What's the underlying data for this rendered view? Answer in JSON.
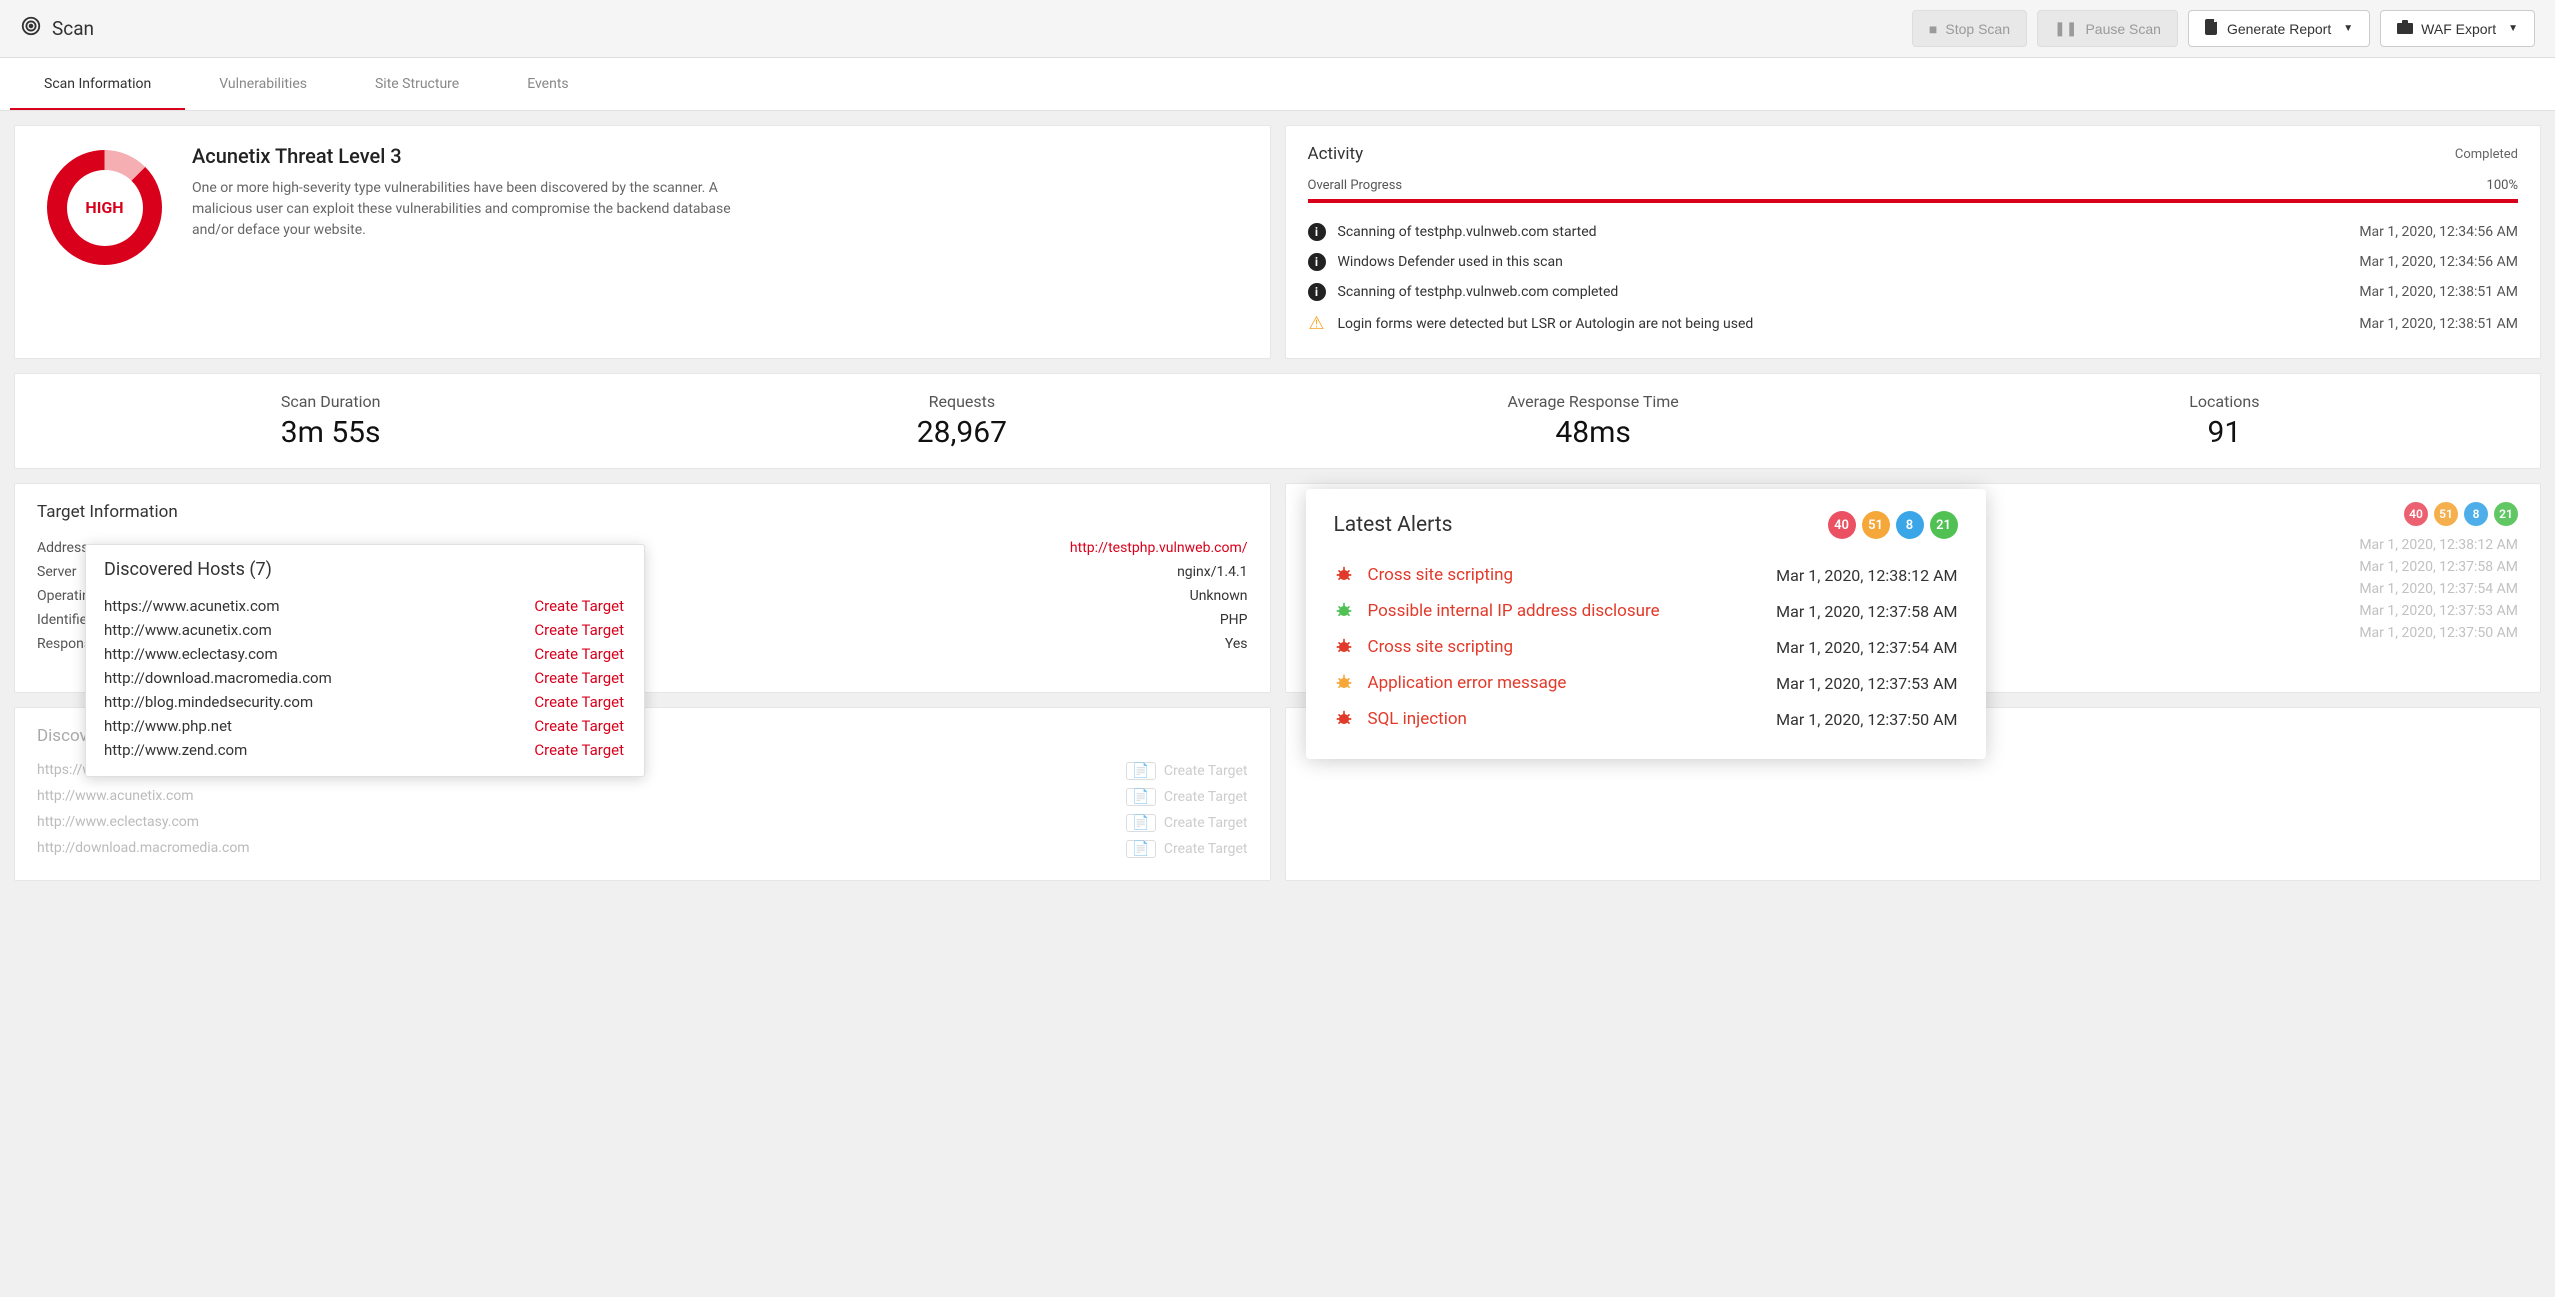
{
  "toolbar": {
    "title": "Scan",
    "stop": "Stop Scan",
    "pause": "Pause Scan",
    "report": "Generate Report",
    "waf": "WAF Export"
  },
  "tabs": [
    "Scan Information",
    "Vulnerabilities",
    "Site Structure",
    "Events"
  ],
  "activeTab": 0,
  "threat": {
    "level_label": "HIGH",
    "title": "Acunetix Threat Level 3",
    "desc": "One or more high-severity type vulnerabilities have been discovered by the scanner. A malicious user can exploit these vulnerabilities and compromise the backend database and/or deface your website."
  },
  "activity": {
    "title": "Activity",
    "status": "Completed",
    "progress_label": "Overall Progress",
    "progress_value": "100%",
    "items": [
      {
        "type": "info",
        "msg": "Scanning of testphp.vulnweb.com started",
        "ts": "Mar 1, 2020, 12:34:56 AM"
      },
      {
        "type": "info",
        "msg": "Windows Defender used in this scan",
        "ts": "Mar 1, 2020, 12:34:56 AM"
      },
      {
        "type": "info",
        "msg": "Scanning of testphp.vulnweb.com completed",
        "ts": "Mar 1, 2020, 12:38:51 AM"
      },
      {
        "type": "warn",
        "msg": "Login forms were detected but LSR or Autologin are not being used",
        "ts": "Mar 1, 2020, 12:38:51 AM"
      }
    ]
  },
  "stats": [
    {
      "label": "Scan Duration",
      "value": "3m 55s"
    },
    {
      "label": "Requests",
      "value": "28,967"
    },
    {
      "label": "Average Response Time",
      "value": "48ms"
    },
    {
      "label": "Locations",
      "value": "91"
    }
  ],
  "target": {
    "title": "Target Information",
    "rows": [
      {
        "k": "Address",
        "v": "http://testphp.vulnweb.com/",
        "link": true
      },
      {
        "k": "Server",
        "v": "nginx/1.4.1"
      },
      {
        "k": "Operating System",
        "v": "Unknown"
      },
      {
        "k": "Identified Technologies",
        "v": "PHP"
      },
      {
        "k": "Responsive",
        "v": "Yes"
      }
    ]
  },
  "hosts": {
    "title": "Discovered Hosts (7)",
    "create_label": "Create Target",
    "items": [
      "https://www.acunetix.com",
      "http://www.acunetix.com",
      "http://www.eclectasy.com",
      "http://download.macromedia.com",
      "http://blog.mindedsecurity.com",
      "http://www.php.net",
      "http://www.zend.com"
    ]
  },
  "discovered_bg": {
    "title": "Discovered Hosts (7)",
    "items": [
      "https://www.acunetix.com",
      "http://www.acunetix.com",
      "http://www.eclectasy.com",
      "http://download.macromedia.com"
    ],
    "action": "Create Target"
  },
  "alerts_bg": {
    "title": "Latest Alerts",
    "badges": [
      {
        "n": "40",
        "c": "b-red"
      },
      {
        "n": "51",
        "c": "b-orange"
      },
      {
        "n": "8",
        "c": "b-blue"
      },
      {
        "n": "21",
        "c": "b-green"
      }
    ],
    "rows": [
      {
        "name": "Cross site scripting",
        "ts": "Mar 1, 2020, 12:38:12 AM"
      },
      {
        "name": "Possible internal IP address disclosure",
        "ts": "Mar 1, 2020, 12:37:58 AM"
      },
      {
        "name": "Cross site scripting",
        "ts": "Mar 1, 2020, 12:37:54 AM"
      },
      {
        "name": "Application error message",
        "ts": "Mar 1, 2020, 12:37:53 AM"
      },
      {
        "name": "SQL injection",
        "ts": "Mar 1, 2020, 12:37:50 AM"
      }
    ]
  },
  "alerts": {
    "title": "Latest Alerts",
    "badges": [
      {
        "n": "40",
        "c": "b-red"
      },
      {
        "n": "51",
        "c": "b-orange"
      },
      {
        "n": "8",
        "c": "b-blue"
      },
      {
        "n": "21",
        "c": "b-green"
      }
    ],
    "items": [
      {
        "color": "#e23a2a",
        "name": "Cross site scripting",
        "ts": "Mar 1, 2020, 12:38:12 AM"
      },
      {
        "color": "#51c154",
        "name": "Possible internal IP address disclosure",
        "ts": "Mar 1, 2020, 12:37:58 AM"
      },
      {
        "color": "#e23a2a",
        "name": "Cross site scripting",
        "ts": "Mar 1, 2020, 12:37:54 AM"
      },
      {
        "color": "#f5a73a",
        "name": "Application error message",
        "ts": "Mar 1, 2020, 12:37:53 AM"
      },
      {
        "color": "#e23a2a",
        "name": "SQL injection",
        "ts": "Mar 1, 2020, 12:37:50 AM"
      }
    ]
  }
}
